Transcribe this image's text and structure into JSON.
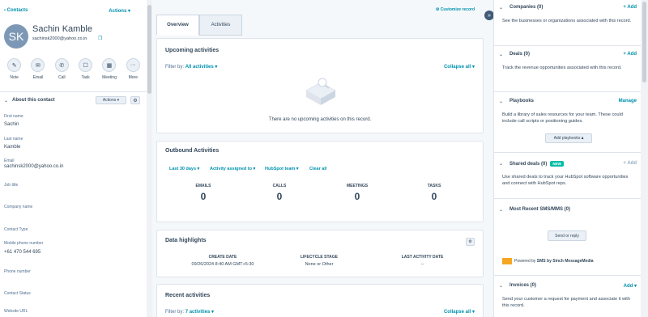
{
  "left": {
    "back": "Contacts",
    "actions": "Actions",
    "initials": "SK",
    "name": "Sachin Kamble",
    "email": "sachinsk2000@yahoo.co.in",
    "quick_actions": [
      {
        "label": "Note",
        "icon": "note-icon"
      },
      {
        "label": "Email",
        "icon": "email-icon"
      },
      {
        "label": "Call",
        "icon": "call-icon"
      },
      {
        "label": "Task",
        "icon": "task-icon"
      },
      {
        "label": "Meeting",
        "icon": "meeting-icon"
      },
      {
        "label": "More",
        "icon": "more-icon"
      }
    ],
    "about_title": "About this contact",
    "about_actions": "Actions",
    "fields": [
      {
        "label": "First name",
        "value": "Sachin"
      },
      {
        "label": "Last name",
        "value": "Kamble"
      },
      {
        "label": "Email",
        "value": "sachinsk2000@yahoo.co.in"
      },
      {
        "label": "Job title",
        "value": ""
      },
      {
        "label": "Company name",
        "value": ""
      },
      {
        "label": "Contact Type",
        "value": ""
      },
      {
        "label": "Mobile phone number",
        "value": "+61 470 544 695"
      },
      {
        "label": "Phone number",
        "value": ""
      },
      {
        "label": "Contact Status",
        "value": ""
      },
      {
        "label": "Website URL",
        "value": ""
      }
    ]
  },
  "mid": {
    "tabs": [
      "Overview",
      "Activities"
    ],
    "customize": "Customize record",
    "upcoming": {
      "title": "Upcoming activities",
      "filter_label": "Filter by:",
      "filter_value": "All activities",
      "collapse": "Collapse all",
      "empty": "There are no upcoming activities on this record."
    },
    "outbound": {
      "title": "Outbound Activities",
      "filters": [
        "Last 30 days",
        "Activity assigned to",
        "HubSpot team"
      ],
      "clear": "Clear all",
      "stats": [
        {
          "k": "EMAILS",
          "v": "0"
        },
        {
          "k": "CALLS",
          "v": "0"
        },
        {
          "k": "MEETINGS",
          "v": "0"
        },
        {
          "k": "TASKS",
          "v": "0"
        }
      ]
    },
    "highlights": {
      "title": "Data highlights",
      "cols": [
        {
          "k": "CREATE DATE",
          "v": "09/26/2024 8:40 AM GMT+5:30"
        },
        {
          "k": "LIFECYCLE STAGE",
          "v": "None or Other"
        },
        {
          "k": "LAST ACTIVITY DATE",
          "v": "--"
        }
      ]
    },
    "recent": {
      "title": "Recent activities",
      "filter_label": "Filter by:",
      "filter_value": "7 activities",
      "collapse": "Collapse all"
    }
  },
  "right": {
    "sections": [
      {
        "title": "Companies (0)",
        "action": "+ Add",
        "body": "See the businesses or organizations associated with this record."
      },
      {
        "title": "Deals (0)",
        "action": "+ Add",
        "body": "Track the revenue opportunities associated with this record."
      },
      {
        "title": "Playbooks",
        "action": "Manage",
        "body": "Build a library of sales resources for your team. These could include call scripts or positioning guides.",
        "button": "Add playbooks"
      },
      {
        "title": "Shared deals (0)",
        "badge": "NEW",
        "action": "+ Add",
        "body": "Use shared deals to track your HubSpot software opportunities and connect with HubSpot reps."
      },
      {
        "title": "Most Recent SMS/MMS (0)",
        "action": "",
        "button": "Send or reply",
        "powered_prefix": "Powered by",
        "powered_name": "SMS by Sinch MessageMedia"
      },
      {
        "title": "Invoices (0)",
        "action": "Add",
        "body": "Send your customer a request for payment and associate it with this record."
      }
    ]
  }
}
